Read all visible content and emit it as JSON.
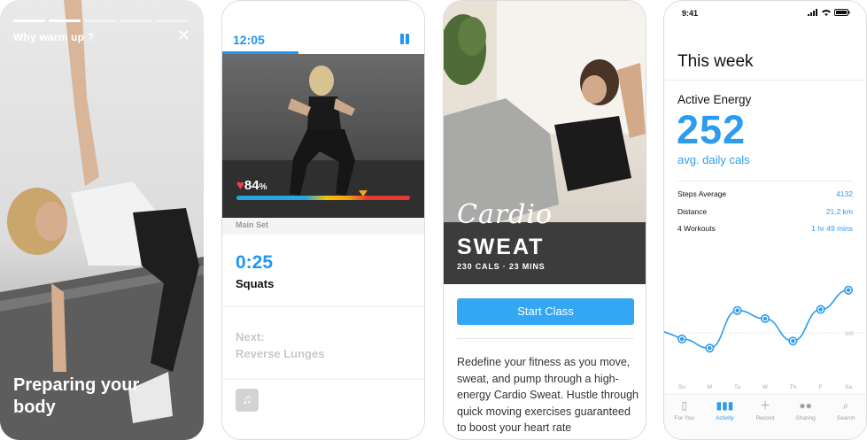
{
  "screen1": {
    "title": "Why warm up ?",
    "close_icon": "close-icon",
    "progress_segments": 5,
    "progress_done": 2,
    "caption": "Preparing your body"
  },
  "screen2": {
    "timer": "12:05",
    "pause_icon": "pause-icon",
    "heart_icon": "heart-icon",
    "heart_rate": "84",
    "heart_rate_unit": "%",
    "section": "Main Set",
    "exercise_time": "0:25",
    "exercise_name": "Squats",
    "next_label": "Next:",
    "next_exercise": "Reverse Lunges",
    "music_icon": "music-icon"
  },
  "screen3": {
    "class_script": "Cardio",
    "class_name": "SWEAT",
    "class_meta": "230 CALS · 23 MINS",
    "button": "Start Class",
    "description": "Redefine your fitness as you move, sweat, and pump through a high-energy Cardio Sweat. Hustle through quick moving exercises guaranteed to boost your heart rate"
  },
  "screen4": {
    "status_time": "9:41",
    "heading": "This week",
    "card_title": "Active Energy",
    "value": "252",
    "unit": "avg. daily cals",
    "stats": [
      {
        "label": "Steps Average",
        "value": "4132"
      },
      {
        "label": "Distance",
        "value": "21.2 km"
      },
      {
        "label": "4 Workouts",
        "value": "1 hr 49 mins"
      }
    ],
    "chart_data": {
      "type": "line",
      "x": [
        "Su",
        "M",
        "Tu",
        "W",
        "Th",
        "F",
        "Sa"
      ],
      "values": [
        270,
        225,
        410,
        370,
        260,
        415,
        510
      ],
      "reference_line": 300,
      "reference_label": "300",
      "ylim": [
        100,
        600
      ],
      "color": "#2d9cee"
    },
    "tabs": [
      {
        "label": "For You",
        "icon": "phone-icon",
        "active": false
      },
      {
        "label": "Activity",
        "icon": "bar-chart-icon",
        "active": true
      },
      {
        "label": "Record",
        "icon": "plus-icon",
        "active": false
      },
      {
        "label": "Sharing",
        "icon": "sharing-icon",
        "active": false
      },
      {
        "label": "Search",
        "icon": "search-icon",
        "active": false
      }
    ]
  },
  "colors": {
    "accent_blue": "#2196f3",
    "chart_blue": "#2d9cee",
    "button_blue": "#33a7f2"
  }
}
